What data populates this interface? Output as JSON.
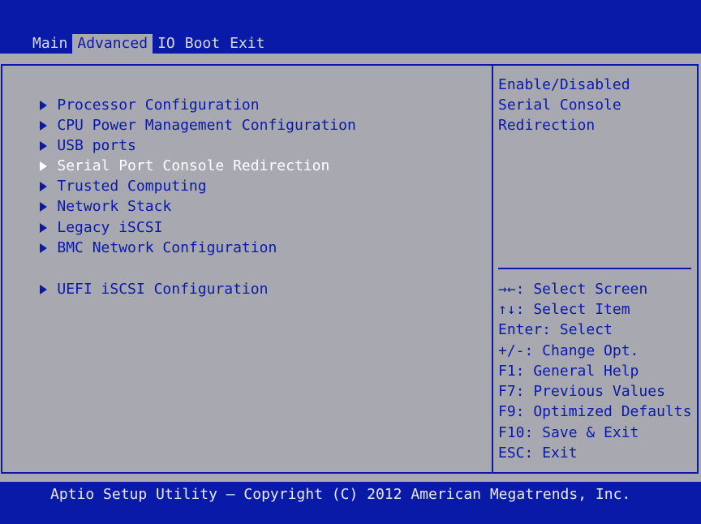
{
  "colors": {
    "background": "#0a1aa8",
    "panel": "#a8a8b0",
    "text_dark": "#0a1aa8",
    "text_light": "#ffffff"
  },
  "tabs": [
    {
      "label": "Main",
      "active": false
    },
    {
      "label": "Advanced",
      "active": true
    },
    {
      "label": "IO",
      "active": false
    },
    {
      "label": "Boot",
      "active": false
    },
    {
      "label": "Exit",
      "active": false
    }
  ],
  "menu": {
    "items": [
      {
        "label": "Processor Configuration",
        "icon": "triangle-right-icon"
      },
      {
        "label": "CPU Power Management Configuration",
        "icon": "triangle-right-icon"
      },
      {
        "label": "USB ports",
        "icon": "triangle-right-icon"
      },
      {
        "label": "Serial Port Console Redirection",
        "icon": "triangle-right-icon",
        "selected": true
      },
      {
        "label": "Trusted Computing",
        "icon": "triangle-right-icon"
      },
      {
        "label": "Network Stack",
        "icon": "triangle-right-icon"
      },
      {
        "label": "Legacy iSCSI",
        "icon": "triangle-right-icon"
      },
      {
        "label": "BMC Network Configuration",
        "icon": "triangle-right-icon"
      },
      {
        "label": "UEFI iSCSI Configuration",
        "icon": "triangle-right-icon"
      }
    ]
  },
  "help": {
    "description": [
      "Enable/Disabled",
      "Serial Console",
      "Redirection"
    ],
    "keys": [
      "→←: Select Screen",
      "↑↓: Select Item",
      "Enter: Select",
      "+/-: Change Opt.",
      "F1: General Help",
      "F7: Previous Values",
      "F9: Optimized Defaults",
      "F10: Save & Exit",
      "ESC: Exit"
    ]
  },
  "footer": {
    "text": "Aptio Setup Utility – Copyright (C) 2012 American Megatrends, Inc."
  }
}
